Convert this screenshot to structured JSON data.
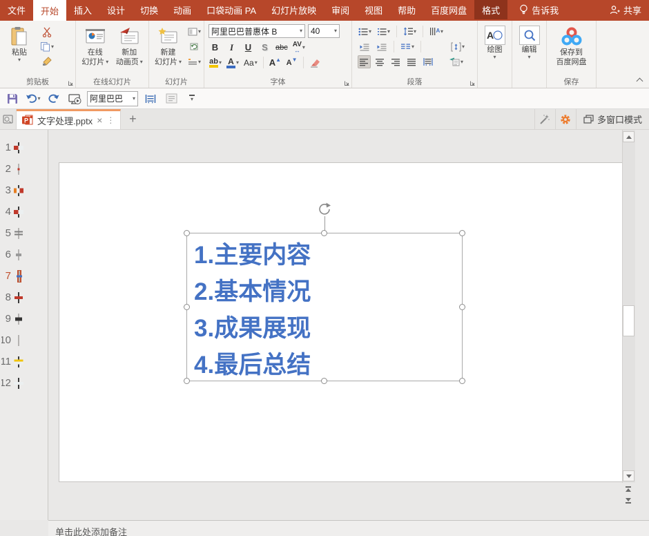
{
  "icons": {
    "dropdown": "▾",
    "close": "×",
    "dots": "⋮",
    "plus": "+",
    "arrows_h": "↔"
  },
  "menu": {
    "tabs": [
      {
        "label": "文件"
      },
      {
        "label": "开始"
      },
      {
        "label": "插入"
      },
      {
        "label": "设计"
      },
      {
        "label": "切换"
      },
      {
        "label": "动画"
      },
      {
        "label": "口袋动画 PA"
      },
      {
        "label": "幻灯片放映"
      },
      {
        "label": "审阅"
      },
      {
        "label": "视图"
      },
      {
        "label": "帮助"
      },
      {
        "label": "百度网盘"
      },
      {
        "label": "格式"
      }
    ],
    "tell_me": "告诉我",
    "share": "共享"
  },
  "ribbon": {
    "clipboard": {
      "group": "剪贴板",
      "paste": "粘贴"
    },
    "online": {
      "group": "在线幻灯片",
      "online_l1": "在线",
      "online_l2": "幻灯片",
      "anim_l1": "新加",
      "anim_l2": "动画页"
    },
    "slides": {
      "group": "幻灯片",
      "new_l1": "新建",
      "new_l2": "幻灯片"
    },
    "font": {
      "group": "字体",
      "name": "阿里巴巴普惠体 B",
      "size": "40",
      "bold": "B",
      "italic": "I",
      "underline": "U",
      "shadow": "S",
      "strike": "abc",
      "spacing": "AV",
      "highlight": "ab",
      "color": "A",
      "case": "Aa",
      "grow": "A",
      "shrink": "A"
    },
    "paragraph": {
      "group": "段落"
    },
    "draw": {
      "label": "绘图"
    },
    "edit": {
      "label": "编辑"
    },
    "save": {
      "group": "保存",
      "btn_l1": "保存到",
      "btn_l2": "百度网盘"
    }
  },
  "qat": {
    "font": "阿里巴巴"
  },
  "tabbar": {
    "doc_title": "文字处理.pptx",
    "multi_window": "多窗口模式"
  },
  "slide_panel": {
    "slides": [
      {
        "num": "1"
      },
      {
        "num": "2"
      },
      {
        "num": "3"
      },
      {
        "num": "4"
      },
      {
        "num": "5"
      },
      {
        "num": "6"
      },
      {
        "num": "7"
      },
      {
        "num": "8"
      },
      {
        "num": "9"
      },
      {
        "num": "10"
      },
      {
        "num": "11"
      },
      {
        "num": "12"
      }
    ],
    "selected": 7
  },
  "slide": {
    "lines": [
      "1.主要内容",
      "2.基本情况",
      "3.成果展现",
      "4.最后总结"
    ],
    "text_color": "#4472C4",
    "font_size_pt": "40"
  },
  "notes": {
    "placeholder": "单击此处添加备注"
  },
  "colors": {
    "titlebar": "#B7472A",
    "contextual_tab": "#8E331C",
    "selection": "#C0502F",
    "gear": "#ED7D31",
    "accent_blue": "#4472C4"
  }
}
